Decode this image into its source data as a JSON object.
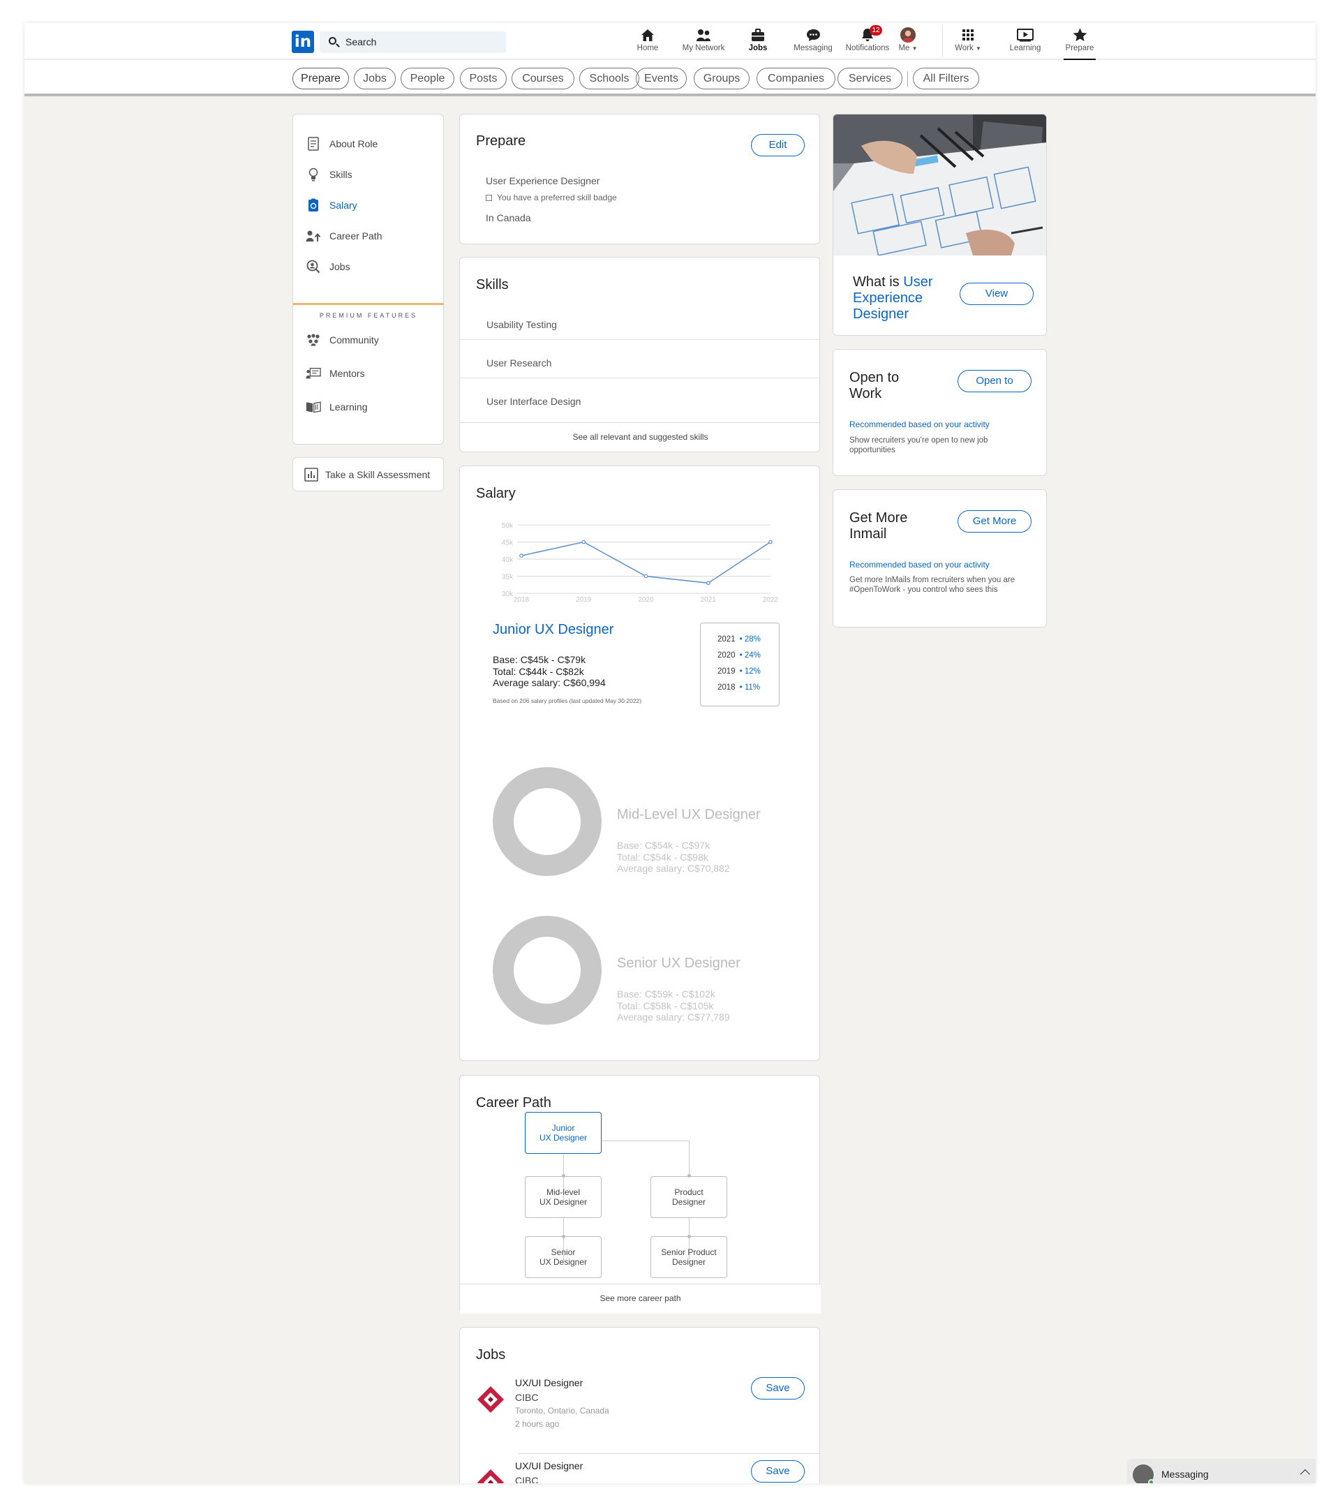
{
  "nav": {
    "logo": "in",
    "search_label": "Search",
    "items": [
      {
        "label": "Home",
        "icon": "home-icon"
      },
      {
        "label": "My Network",
        "icon": "network-icon"
      },
      {
        "label": "Jobs",
        "icon": "briefcase-icon"
      },
      {
        "label": "Messaging",
        "icon": "messaging-icon"
      },
      {
        "label": "Notifications",
        "icon": "bell-icon",
        "badge": "12"
      },
      {
        "label": "Me",
        "icon": "avatar"
      },
      {
        "label": "Work",
        "icon": "grid-icon"
      },
      {
        "label": "Learning",
        "icon": "learning-icon"
      },
      {
        "label": "Prepare",
        "icon": "star-icon"
      }
    ],
    "active": "Jobs",
    "selected": "Prepare"
  },
  "filters": [
    "Prepare",
    "Jobs",
    "People",
    "Posts",
    "Courses",
    "Schools",
    "Events",
    "Groups",
    "Companies",
    "Services",
    "All Filters"
  ],
  "sidebar": {
    "items": [
      {
        "label": "About Role",
        "icon": "document-icon"
      },
      {
        "label": "Skills",
        "icon": "lightbulb-icon"
      },
      {
        "label": "Salary",
        "icon": "salary-icon",
        "active": true
      },
      {
        "label": "Career Path",
        "icon": "career-path-icon"
      },
      {
        "label": "Jobs",
        "icon": "search-jobs-icon"
      }
    ],
    "premium_label": "PREMIUM FEATURES",
    "premium_items": [
      {
        "label": "Community",
        "icon": "community-icon"
      },
      {
        "label": "Mentors",
        "icon": "mentors-icon"
      },
      {
        "label": "Learning",
        "icon": "book-icon"
      }
    ],
    "assessment_label": "Take a Skill Assessment"
  },
  "prepare": {
    "title": "Prepare",
    "edit": "Edit",
    "role": "User Experience Designer",
    "badge_note": "You have a preferred skill badge",
    "location": "In Canada"
  },
  "skills": {
    "title": "Skills",
    "items": [
      "Usability Testing",
      "User Research",
      "User Interface Design"
    ],
    "footer": "See all relevant and suggested skills"
  },
  "salary": {
    "title": "Salary",
    "junior": {
      "title": "Junior UX Designer",
      "base": "Base: C$45k - C$79k",
      "total": "Total: C$44k - C$82k",
      "avg": "Average salary: C$60,994",
      "note": "Based on 206 salary profiles (last updated May 30 2022)"
    },
    "legend": [
      {
        "year": "2021",
        "pct": "28%"
      },
      {
        "year": "2020",
        "pct": "24%"
      },
      {
        "year": "2019",
        "pct": "12%"
      },
      {
        "year": "2018",
        "pct": "11%"
      }
    ],
    "mid": {
      "title": "Mid-Level UX Designer",
      "base": "Base: C$54k - C$97k",
      "total": "Total: C$54k - C$98k",
      "avg": "Average salary: C$70,882"
    },
    "senior": {
      "title": "Senior UX Designer",
      "base": "Base: C$59k - C$102k",
      "total": "Total: C$58k - C$105k",
      "avg": "Average salary: C$77,789"
    }
  },
  "chart_data": {
    "type": "line",
    "x": [
      2018,
      2019,
      2020,
      2021,
      2022
    ],
    "values": [
      41,
      45,
      35,
      33,
      45
    ],
    "ylim": [
      30,
      50
    ],
    "yticks": [
      "30k",
      "35k",
      "40k",
      "45k",
      "50k"
    ],
    "xticks": [
      "2018",
      "2019",
      "2020",
      "2021",
      "2022"
    ],
    "grid": true,
    "color": "#5b8fd0"
  },
  "career": {
    "title": "Career Path",
    "nodes": {
      "junior": "Junior\nUX Designer",
      "mid": "Mid-level\nUX Designer",
      "product": "Product\nDesigner",
      "senior": "Senior\nUX Designer",
      "senior_product": "Senior Product\nDesigner"
    },
    "footer": "See more career path"
  },
  "jobs": {
    "title": "Jobs",
    "items": [
      {
        "title": "UX/UI Designer",
        "company": "CIBC",
        "location": "Toronto, Ontario, Canada",
        "age": "2 hours ago",
        "save": "Save"
      },
      {
        "title": "UX/UI Designer",
        "company": "CIBC",
        "location": "",
        "age": "",
        "save": "Save"
      }
    ]
  },
  "right": {
    "what_prefix": "What is ",
    "what_role": "User Experience Designer",
    "view": "View",
    "open_title": "Open to Work",
    "open_btn": "Open to",
    "open_rec": "Recommended based on your activity",
    "open_desc": "Show recruiters you're open to new job opportunities",
    "inmail_title": "Get More Inmail",
    "inmail_btn": "Get More",
    "inmail_rec": "Recommended based on your activity",
    "inmail_desc": "Get more InMails from recruiters when you are #OpenToWork -  you control who sees this"
  },
  "messaging": {
    "label": "Messaging"
  },
  "colors": {
    "brand": "#0a66c2",
    "premium": "#f4b46a",
    "cibc": "#c41f3e"
  }
}
